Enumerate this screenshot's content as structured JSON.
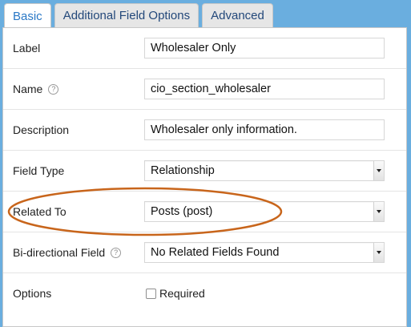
{
  "tabs": [
    {
      "label": "Basic",
      "active": true
    },
    {
      "label": "Additional Field Options",
      "active": false
    },
    {
      "label": "Advanced",
      "active": false
    }
  ],
  "fields": {
    "label": {
      "label": "Label",
      "value": "Wholesaler Only"
    },
    "name": {
      "label": "Name",
      "help": "?",
      "value": "cio_section_wholesaler"
    },
    "description": {
      "label": "Description",
      "value": "Wholesaler only information."
    },
    "field_type": {
      "label": "Field Type",
      "value": "Relationship"
    },
    "related_to": {
      "label": "Related To",
      "value": "Posts (post)"
    },
    "bidirectional": {
      "label": "Bi-directional Field",
      "help": "?",
      "value": "No Related Fields Found"
    },
    "options": {
      "label": "Options",
      "checkbox_label": "Required",
      "checked": false
    }
  },
  "colors": {
    "background": "#6aaedf",
    "active_tab_text": "#2a78c6",
    "tab_text": "#23487a",
    "highlight": "#c8651b"
  }
}
